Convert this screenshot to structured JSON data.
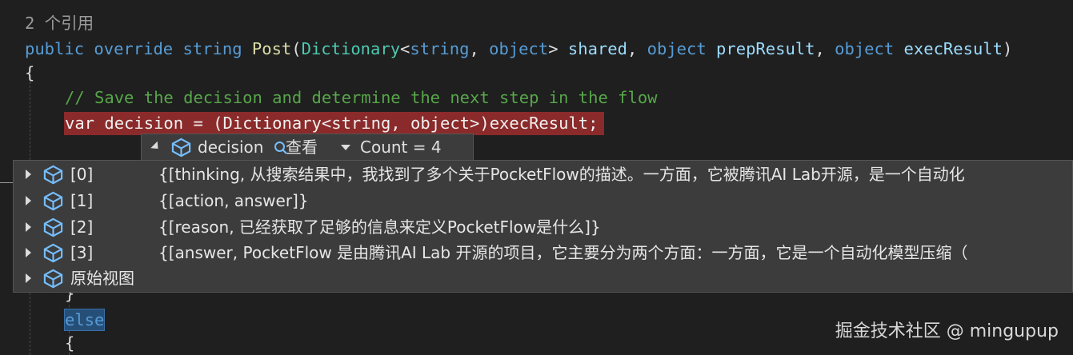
{
  "code": {
    "refs": "2 个引用",
    "signature": {
      "kw_public": "public",
      "kw_override": "override",
      "kw_string": "string",
      "method": "Post",
      "paren_open": "(",
      "type_dict": "Dictionary",
      "lt": "<",
      "kw_string2": "string",
      "comma1": ", ",
      "kw_object1": "object",
      "gt": ">",
      "param_shared": " shared",
      "comma2": ", ",
      "kw_object2": "object",
      "param_prep": " prepResult",
      "comma3": ", ",
      "kw_object3": "object",
      "param_exec": " execResult",
      "paren_close": ")"
    },
    "open_brace": "{",
    "comment": "// Save the decision and determine the next step in the flow",
    "breakpoint_line": "var decision = (Dictionary<string, object>)execResult;",
    "close_brace": "}",
    "else_kw": "else",
    "open_brace2": "{"
  },
  "datatip": {
    "variable": "decision",
    "view_label": "查看",
    "count": "Count = 4",
    "rows": [
      {
        "key": "[0]",
        "value": "{[thinking, 从搜索结果中，我找到了多个关于PocketFlow的描述。一方面，它被腾讯AI Lab开源，是一个自动化"
      },
      {
        "key": "[1]",
        "value": "{[action, answer]}"
      },
      {
        "key": "[2]",
        "value": "{[reason, 已经获取了足够的信息来定义PocketFlow是什么]}"
      },
      {
        "key": "[3]",
        "value": "{[answer, PocketFlow 是由腾讯AI Lab 开源的项目，它主要分为两个方面：一方面，它是一个自动化模型压缩（"
      }
    ],
    "raw_view": "原始视图"
  },
  "watermark": "掘金技术社区 @ mingupup",
  "colors": {
    "background": "#1f1f1f",
    "keyword": "#569cd6",
    "type": "#4ec9b0",
    "method": "#dcdcaa",
    "comment": "#57a64a",
    "breakpoint": "#8b2a2a",
    "tip_bg": "#3c3c3c"
  }
}
